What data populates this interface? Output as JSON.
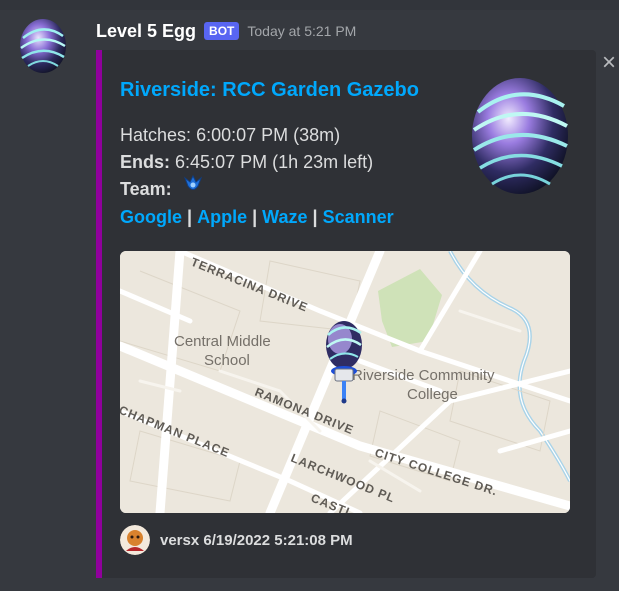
{
  "message": {
    "username": "Level 5 Egg",
    "bot_badge": "BOT",
    "timestamp": "Today at 5:21 PM"
  },
  "embed": {
    "accent_color": "#90009c",
    "title": "Riverside: RCC Garden Gazebo",
    "hatches_label": "Hatches:",
    "hatches_value": "6:00:07 PM (38m)",
    "ends_label": "Ends:",
    "ends_value": "6:45:07 PM (1h 23m left)",
    "team_label": "Team:",
    "team_icon": "mystic-team-icon",
    "links": [
      "Google",
      "Apple",
      "Waze",
      "Scanner"
    ],
    "link_separator": "|",
    "map": {
      "labels": {
        "terracina": "TERRACINA DRIVE",
        "central_middle": "Central Middle",
        "school": "School",
        "riverside_cc": "Riverside Community",
        "college": "College",
        "ramona": "RAMONA DRIVE",
        "chapman": "CHAPMAN PLACE",
        "larchwood": "LARCHWOOD PL",
        "city_college": "CITY COLLEGE DR.",
        "castle": "CASTL"
      }
    },
    "footer": {
      "text": "versx 6/19/2022 5:21:08 PM"
    }
  },
  "close_icon": "close-icon"
}
